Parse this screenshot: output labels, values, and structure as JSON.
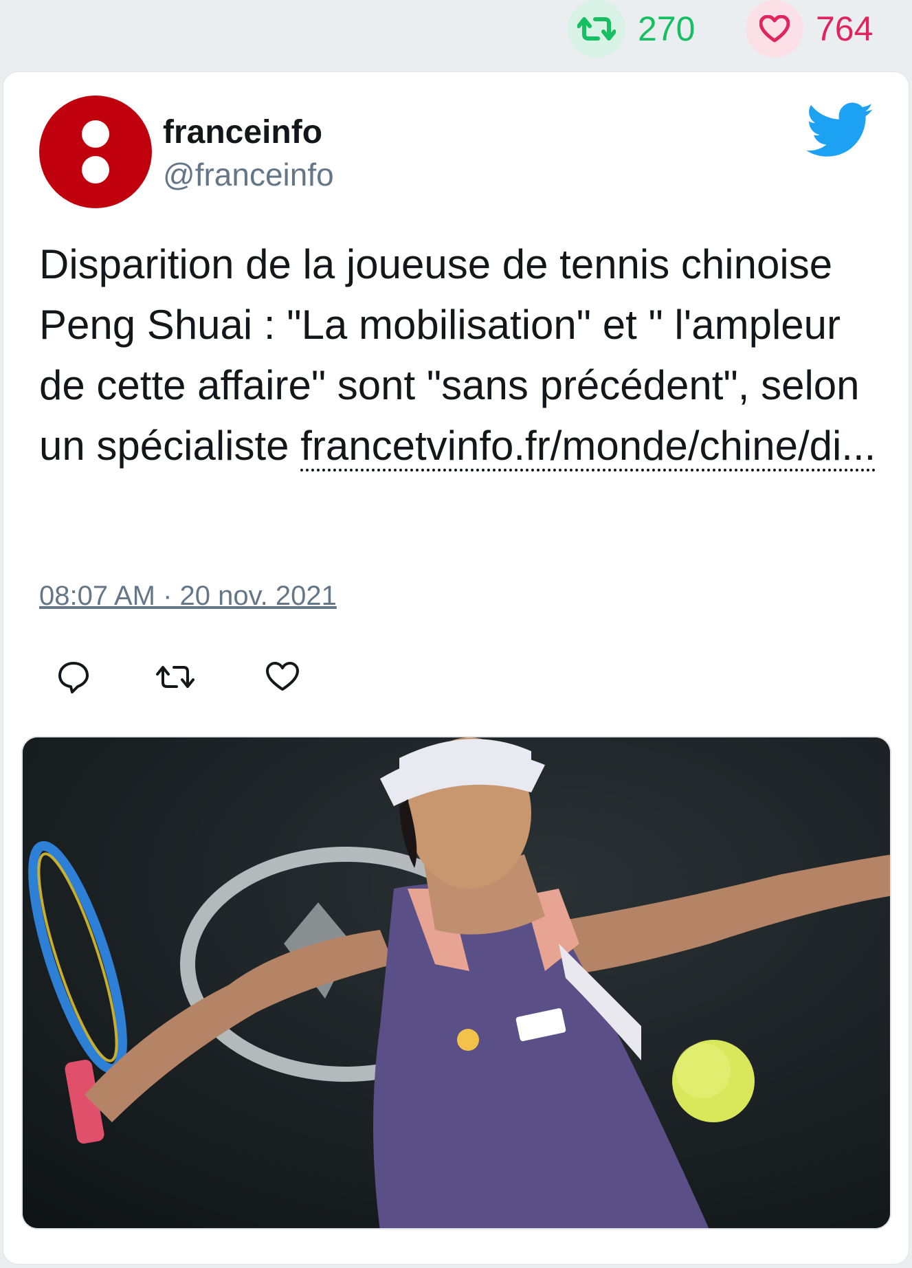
{
  "stats": {
    "retweet_icon": "retweet-icon",
    "retweet_count": "270",
    "like_icon": "heart-icon",
    "like_count": "764",
    "retweet_color": "#17bf63",
    "like_color": "#e0245e"
  },
  "tweet": {
    "author_name": "franceinfo",
    "author_handle": "@franceinfo",
    "avatar_color": "#c0000c",
    "text": "Disparition de la joueuse de tennis chinoise Peng Shuai : \"La mobilisation\" et \" l'ampleur de cette affaire\" sont \"sans précédent\", selon un spécialiste ",
    "link": "francetvinfo.fr/monde/chine/di...",
    "timestamp": "08:07 AM · 20 nov. 2021",
    "actions": [
      "reply-icon",
      "retweet-icon",
      "heart-icon"
    ],
    "media": "tennis-player-photo"
  },
  "brand": {
    "logo": "twitter-bird-icon",
    "color": "#1da1f2"
  }
}
